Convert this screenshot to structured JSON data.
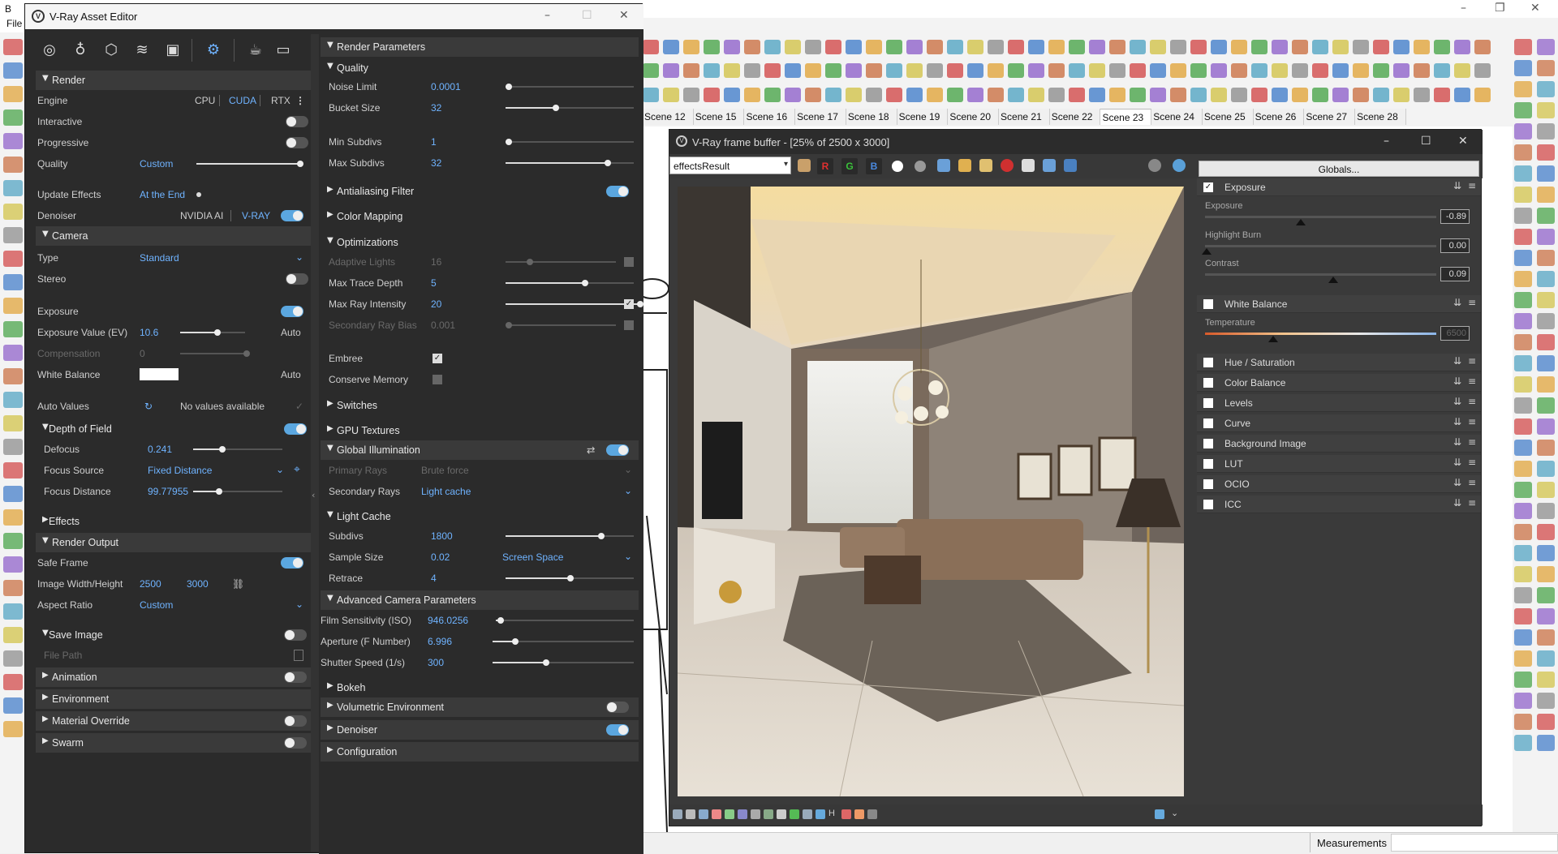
{
  "sketchup": {
    "title_prefix": "B",
    "menu_file": "File",
    "scenes": [
      "Scene 12",
      "Scene 15",
      "Scene 16",
      "Scene 17",
      "Scene 18",
      "Scene 19",
      "Scene 20",
      "Scene 21",
      "Scene 22",
      "Scene 23",
      "Scene 24",
      "Scene 25",
      "Scene 26",
      "Scene 27",
      "Scene 28"
    ],
    "active_scene": "Scene 23",
    "status_measurements": "Measurements"
  },
  "asset_editor": {
    "title": "V-Ray Asset Editor",
    "render": {
      "header": "Render",
      "engine_label": "Engine",
      "engines": [
        "CPU",
        "CUDA",
        "RTX"
      ],
      "interactive_label": "Interactive",
      "progressive_label": "Progressive",
      "quality_label": "Quality",
      "quality_value": "Custom",
      "update_effects_label": "Update Effects",
      "update_effects_value": "At the End",
      "denoiser_label": "Denoiser",
      "denoiser_options": [
        "NVIDIA AI",
        "V-RAY"
      ]
    },
    "camera": {
      "header": "Camera",
      "type_label": "Type",
      "type_value": "Standard",
      "stereo_label": "Stereo",
      "exposure_label": "Exposure",
      "ev_label": "Exposure Value (EV)",
      "ev_value": "10.6",
      "ev_auto": "Auto",
      "compensation_label": "Compensation",
      "compensation_value": "0",
      "white_balance_label": "White Balance",
      "wb_auto": "Auto",
      "auto_values_label": "Auto Values",
      "auto_values_text": "No values available",
      "dof_header": "Depth of Field",
      "defocus_label": "Defocus",
      "defocus_value": "0.241",
      "focus_source_label": "Focus Source",
      "focus_source_value": "Fixed Distance",
      "focus_distance_label": "Focus Distance",
      "focus_distance_value": "99.77955",
      "effects_header": "Effects"
    },
    "render_output": {
      "header": "Render Output",
      "safe_frame_label": "Safe Frame",
      "size_label": "Image Width/Height",
      "width": "2500",
      "height": "3000",
      "aspect_label": "Aspect Ratio",
      "aspect_value": "Custom",
      "save_image_label": "Save Image",
      "file_path_label": "File Path"
    },
    "left_sections": [
      "Animation",
      "Environment",
      "Material Override",
      "Swarm"
    ],
    "render_parameters": {
      "header": "Render Parameters",
      "quality_header": "Quality",
      "noise_limit_label": "Noise Limit",
      "noise_limit_value": "0.0001",
      "bucket_size_label": "Bucket Size",
      "bucket_size_value": "32",
      "min_subdivs_label": "Min Subdivs",
      "min_subdivs_value": "1",
      "max_subdivs_label": "Max Subdivs",
      "max_subdivs_value": "32",
      "antialiasing_header": "Antialiasing Filter",
      "color_mapping_header": "Color Mapping",
      "optimizations_header": "Optimizations",
      "adaptive_lights_label": "Adaptive Lights",
      "adaptive_lights_value": "16",
      "max_trace_depth_label": "Max Trace Depth",
      "max_trace_depth_value": "5",
      "max_ray_intensity_label": "Max Ray Intensity",
      "max_ray_intensity_value": "20",
      "secondary_ray_bias_label": "Secondary Ray Bias",
      "secondary_ray_bias_value": "0.001",
      "embree_label": "Embree",
      "conserve_memory_label": "Conserve Memory",
      "switches_header": "Switches",
      "gpu_textures_header": "GPU Textures",
      "gi_header": "Global Illumination",
      "primary_rays_label": "Primary Rays",
      "primary_rays_value": "Brute force",
      "secondary_rays_label": "Secondary Rays",
      "secondary_rays_value": "Light cache",
      "light_cache_header": "Light Cache",
      "lc_subdivs_label": "Subdivs",
      "lc_subdivs_value": "1800",
      "sample_size_label": "Sample Size",
      "sample_size_value": "0.02",
      "sample_size_mode": "Screen Space",
      "retrace_label": "Retrace",
      "retrace_value": "4",
      "adv_camera_header": "Advanced Camera Parameters",
      "film_label": "Film Sensitivity (ISO)",
      "film_value": "946.0256",
      "aperture_label": "Aperture (F Number)",
      "aperture_value": "6.996",
      "shutter_label": "Shutter Speed (1/s)",
      "shutter_value": "300",
      "bokeh_header": "Bokeh",
      "volumetric_header": "Volumetric Environment",
      "denoiser_header": "Denoiser",
      "configuration_header": "Configuration"
    }
  },
  "frame_buffer": {
    "title": "V-Ray frame buffer - [25% of 2500 x 3000]",
    "channel": "effectsResult",
    "channels": [
      "R",
      "G",
      "B"
    ],
    "globals": "Globals...",
    "layers": {
      "exposure": {
        "name": "Exposure",
        "checked": true,
        "params": [
          {
            "label": "Exposure",
            "value": "-0.89"
          },
          {
            "label": "Highlight Burn",
            "value": "0.00"
          },
          {
            "label": "Contrast",
            "value": "0.09"
          }
        ]
      },
      "white_balance": {
        "name": "White Balance",
        "temperature_label": "Temperature",
        "temperature_value": "6500"
      },
      "others": [
        "Hue / Saturation",
        "Color Balance",
        "Levels",
        "Curve",
        "Background Image",
        "LUT",
        "OCIO",
        "ICC"
      ]
    },
    "bottom_letter": "H"
  }
}
